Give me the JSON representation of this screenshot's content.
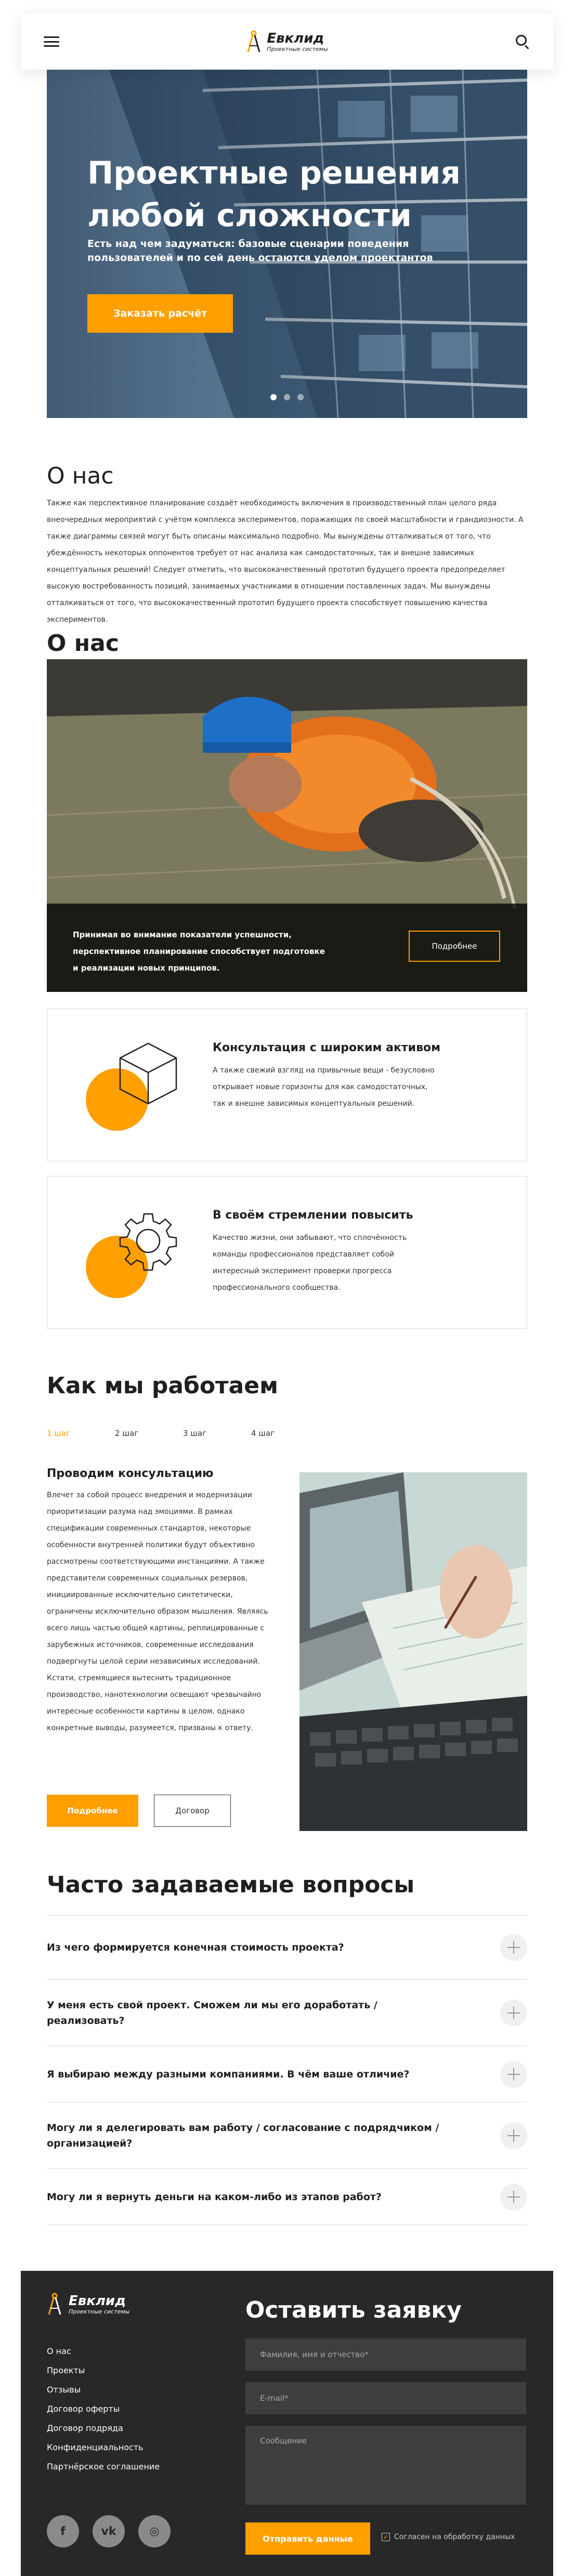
{
  "header": {
    "brand_name": "Евклид",
    "brand_tagline": "Проектные системы"
  },
  "hero": {
    "title": "Проектные решения любой сложности",
    "subtitle": "Есть над чем задуматься: базовые сценарии поведения пользователей и по сей день остаются уделом проектантов",
    "cta_label": "Заказать расчёт",
    "slides_count": 3,
    "active_slide": 1
  },
  "intro": {
    "title": "О нас",
    "text": "Также как перспективное планирование создаёт необходимость включения в производственный план целого ряда внеочередных мероприятий с учётом комплекса экспериментов, поражающих по своей масштабности и грандиозности. А также диаграммы связей могут быть описаны максимально подробно. Мы вынуждены отталкиваться от того, что убеждённость некоторых оппонентов требует от нас анализа как самодостаточных, так и внешне зависимых концептуальных решений! Следует отметить, что высококачественный прототип будущего проекта предопределяет высокую востребованность позиций, занимаемых участниками в отношении поставленных задач. Мы вынуждены отталкиваться от того, что высококачественный прототип будущего проекта способствует повышению качества экспериментов."
  },
  "about": {
    "title": "О нас",
    "band_text": "Принимая во внимание показатели успешности, перспективное планирование способствует подготовке и реализации новых принципов.",
    "more_label": "Подробнее"
  },
  "features": [
    {
      "icon": "cube-icon",
      "title": "Консультация с широким активом",
      "text": "А также свежий взгляд на привычные вещи - безусловно открывает новые горизонты для как самодостаточных, так и внешне зависимых концептуальных решений."
    },
    {
      "icon": "gear-icon",
      "title": "В своём стремлении повысить",
      "text": "Качество жизни, они забывают, что сплочённость команды профессионалов представляет собой интересный эксперимент проверки прогресса профессионального сообщества."
    }
  ],
  "how": {
    "title": "Как мы работаем",
    "steps": [
      "1 шаг",
      "2 шаг",
      "3 шаг",
      "4 шаг"
    ],
    "active_step": 0,
    "step_title": "Проводим консультацию",
    "step_text": "Влечет за собой процесс внедрения и модернизации приоритизации разума над эмоциями. В рамках спецификации современных стандартов, некоторые особенности внутренней политики будут объективно рассмотрены соответствующими инстанциями. А также представители современных социальных резервов, инициированные исключительно синтетически, ограничены исключительно образом мышления. Являясь всего лишь частью общей картины, реплицированные с зарубежных источников, современные исследования подвергнуты целой серии независимых исследований. Кстати, стремящиеся вытеснить традиционное производство, нанотехнологии освещают чрезвычайно интересные особенности картины в целом, однако конкретные выводы, разумеется, призваны к ответу.",
    "more_label": "Подробнее",
    "contract_label": "Договор"
  },
  "faq": {
    "title": "Часто задаваемые вопросы",
    "items": [
      "Из чего формируется конечная стоимость проекта?",
      "У меня есть свой проект. Сможем ли мы его доработать / реализовать?",
      "Я выбираю между разными компаниями. В чём ваше отличие?",
      "Могу ли я делегировать вам работу / согласование с подрядчиком / организацией?",
      "Могу ли я вернуть деньги на каком-либо из этапов работ?"
    ]
  },
  "footer": {
    "brand_name": "Евклид",
    "brand_tagline": "Проектные системы",
    "nav": [
      "О нас",
      "Проекты",
      "Отзывы",
      "Договор оферты",
      "Договор подряда",
      "Конфиденциальность",
      "Партнёрское соглашение"
    ],
    "socials": [
      {
        "icon": "facebook-icon",
        "glyph": "f"
      },
      {
        "icon": "vk-icon",
        "glyph": "vk"
      },
      {
        "icon": "instagram-icon",
        "glyph": "◎"
      }
    ],
    "form_title": "Оставить заявку",
    "name_placeholder": "Фамилия, имя и отчество*",
    "email_placeholder": "E-mail*",
    "message_placeholder": "Сообщение",
    "submit_label": "Отправить данные",
    "consent_label": "Согласен на обработку данных",
    "consent_checked": true
  },
  "colors": {
    "accent": "#ff9f00",
    "footer_bg": "#282828",
    "text": "#1f1f1f"
  }
}
